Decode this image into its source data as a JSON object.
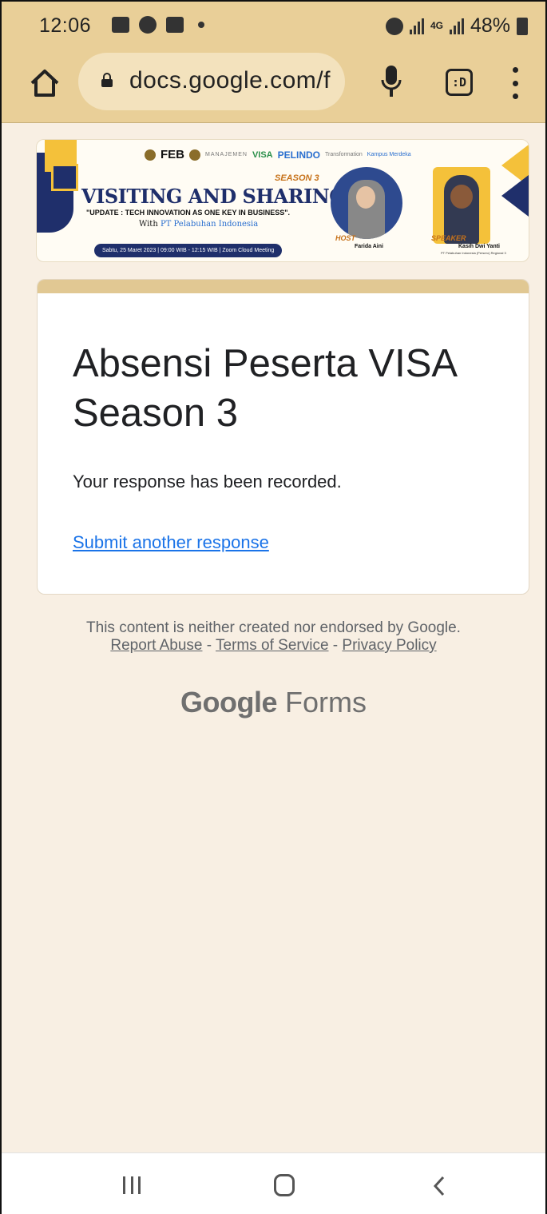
{
  "status_bar": {
    "time": "12:06",
    "battery": "48%",
    "network": "4G"
  },
  "browser": {
    "url": "docs.google.com/f",
    "tabs_label": ":D"
  },
  "banner": {
    "logos": {
      "feb": "FEB",
      "manajemen": "MANAJEMEN",
      "visa": "VISA",
      "pelindo": "PELINDO",
      "transformation": "Transformation",
      "kampus": "Kampus Merdeka"
    },
    "season": "SEASON 3",
    "title": "VISITING AND SHARING",
    "subtitle": "\"UPDATE : TECH INNOVATION AS ONE KEY IN BUSINESS\".",
    "with_prefix": "With",
    "with_company": "PT Pelabuhan Indonesia",
    "date": "Sabtu, 25 Maret 2023 | 09:00 WIB - 12:15 WIB | Zoom Cloud Meeting",
    "host_label": "HOST",
    "host_name": "Farida Aini",
    "speaker_label": "SPEAKER",
    "speaker_name": "Kasih Dwi Yanti",
    "speaker_role": "PT Pelabuhan Indonesia (Persero) Regional 3"
  },
  "form": {
    "title": "Absensi Peserta VISA Season 3",
    "message": "Your response has been recorded.",
    "link": "Submit another response"
  },
  "footer": {
    "disclaimer": "This content is neither created nor endorsed by Google.",
    "report_abuse": "Report Abuse",
    "terms": "Terms of Service",
    "privacy": "Privacy Policy",
    "separator": " - ",
    "brand_google": "Google",
    "brand_forms": "Forms"
  },
  "colors": {
    "chrome": "#e9cf98",
    "page_bg": "#f8efe3",
    "link": "#1a73e8",
    "card_accent": "#e1c893"
  },
  "icons": [
    "gallery-icon",
    "camera-icon",
    "lazada-icon",
    "alarm-icon",
    "signal-icon",
    "battery-icon",
    "home-icon",
    "lock-icon",
    "mic-icon",
    "tabs-icon",
    "overflow-menu-icon",
    "recent-apps-icon",
    "home-nav-icon",
    "back-icon"
  ]
}
